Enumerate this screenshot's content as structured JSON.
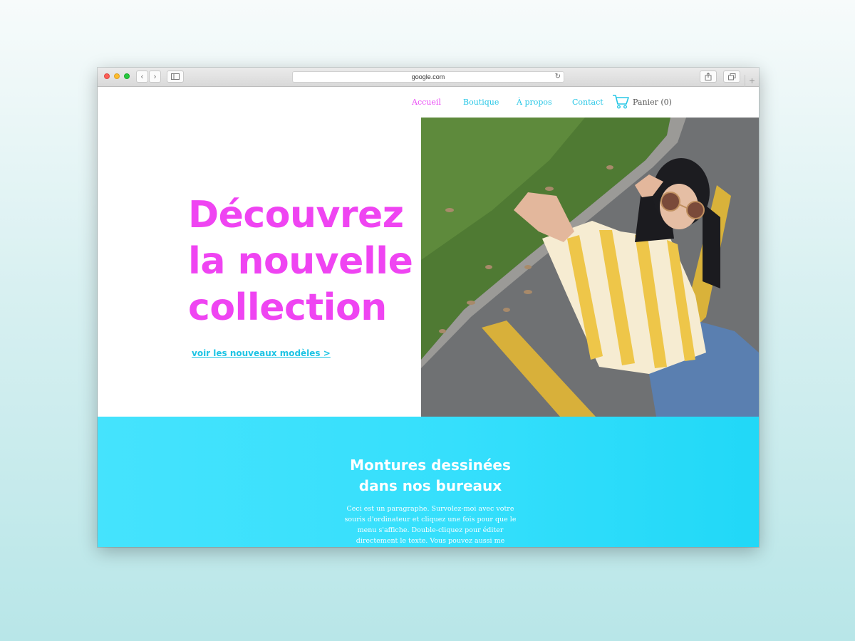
{
  "browser": {
    "url": "google.com"
  },
  "nav": {
    "items": [
      {
        "label": "Accueil",
        "active": true
      },
      {
        "label": "Boutique",
        "active": false
      },
      {
        "label": "À propos",
        "active": false
      },
      {
        "label": "Contact",
        "active": false
      }
    ],
    "cart_label": "Panier (0)",
    "cart_icon": "cart-icon"
  },
  "hero": {
    "headline_lines": [
      "Découvrez",
      "la nouvelle",
      "collection"
    ],
    "cta": "voir les nouveaux modèles >",
    "image": "woman-sunglasses-photo"
  },
  "section": {
    "title_lines": [
      "Montures dessinées",
      "dans nos bureaux"
    ],
    "paragraph": "Ceci est un paragraphe. Survolez-moi avec votre souris d'ordinateur et cliquez une fois pour que le menu s'affiche. Double-cliquez pour éditer directement le texte. Vous pouvez aussi me"
  },
  "colors": {
    "accent_pink": "#ef44f2",
    "accent_cyan": "#28c7e6",
    "band_cyan": "#35dffc"
  }
}
